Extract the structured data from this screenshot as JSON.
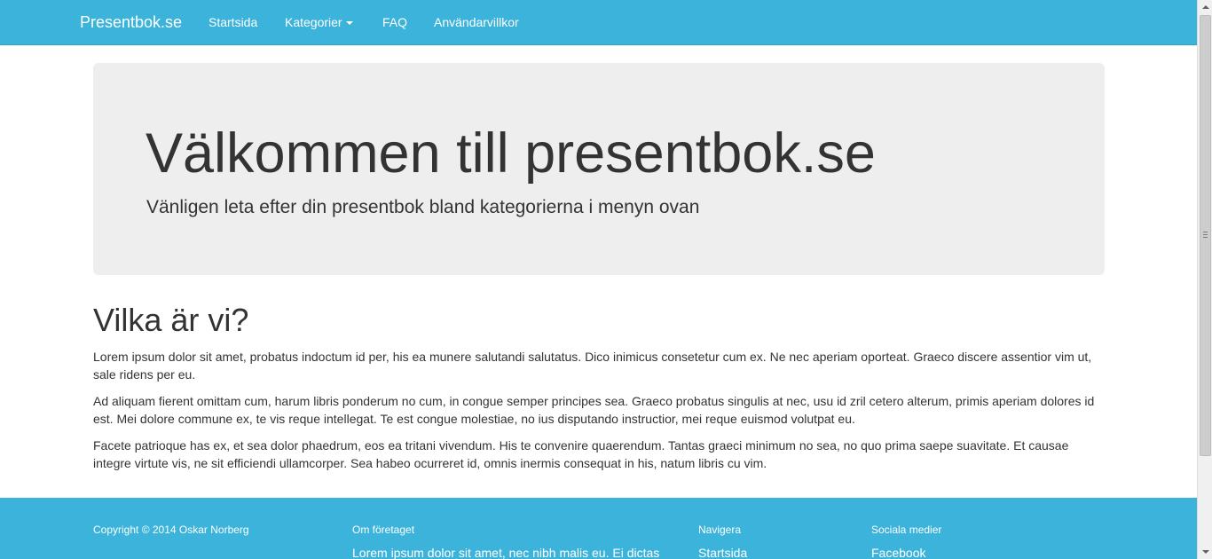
{
  "navbar": {
    "brand": "Presentbok.se",
    "items": [
      {
        "label": "Startsida"
      },
      {
        "label": "Kategorier"
      },
      {
        "label": "FAQ"
      },
      {
        "label": "Användarvillkor"
      }
    ]
  },
  "jumbotron": {
    "heading": "Välkommen till presentbok.se",
    "subheading": "Vänligen leta efter din presentbok bland kategorierna i menyn ovan"
  },
  "about": {
    "heading": "Vilka är vi?",
    "paragraphs": [
      "Lorem ipsum dolor sit amet, probatus indoctum id per, his ea munere salutandi salutatus. Dico inimicus consetetur cum ex. Ne nec aperiam oporteat. Graeco discere assentior vim ut, sale ridens per eu.",
      "Ad aliquam fierent omittam cum, harum libris ponderum no cum, in congue semper principes sea. Graeco probatus singulis at nec, usu id zril cetero alterum, primis aperiam dolores id est. Mei dolore commune ex, te vis reque intellegat. Te est congue molestiae, no ius disputando instructior, mei reque euismod volutpat eu.",
      "Facete patrioque has ex, et sea dolor phaedrum, eos ea tritani vivendum. His te convenire quaerendum. Tantas graeci minimum no sea, no quo prima saepe suavitate. Et causae integre virtute vis, ne sit efficiendi ullamcorper. Sea habeo ocurreret id, omnis inermis consequat in his, natum libris cu vim."
    ]
  },
  "footer": {
    "copyright": "Copyright © 2014 Oskar Norberg",
    "company_heading": "Om företaget",
    "company_text": "Lorem ipsum dolor sit amet, nec nibh malis eu. Ei dictas",
    "nav_heading": "Navigera",
    "nav_first": "Startsida",
    "social_heading": "Sociala medier",
    "social_first": "Facebook"
  },
  "colors": {
    "navbar": "#3bb3da",
    "jumbotron_bg": "#eeeeee",
    "text": "#333333"
  }
}
